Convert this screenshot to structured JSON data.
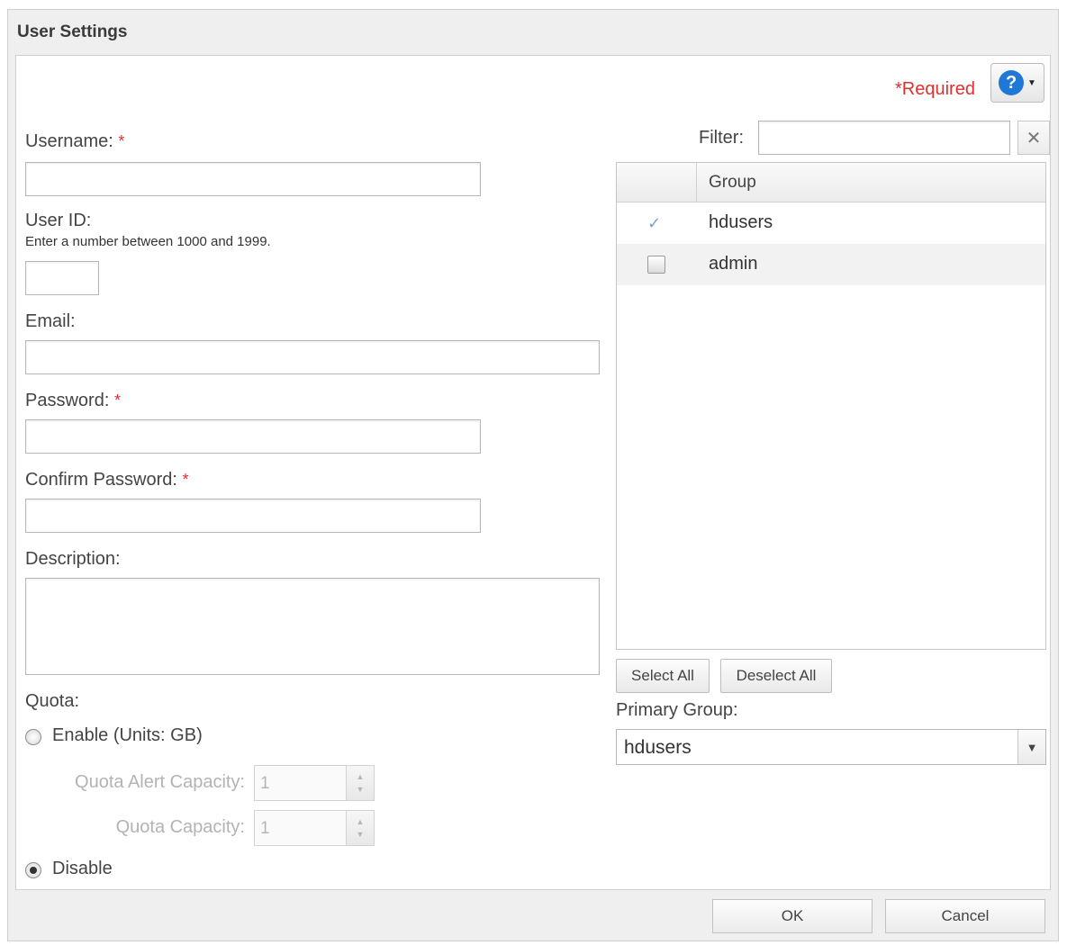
{
  "window": {
    "title": "User Settings"
  },
  "header": {
    "required_note": "*Required"
  },
  "form": {
    "username": {
      "label": "Username:",
      "marker": "*",
      "value": ""
    },
    "user_id": {
      "label": "User ID:",
      "hint": "Enter a number between 1000 and 1999.",
      "value": ""
    },
    "email": {
      "label": "Email:",
      "value": ""
    },
    "password": {
      "label": "Password:",
      "marker": "*",
      "value": ""
    },
    "confirm_password": {
      "label": "Confirm Password:",
      "marker": "*",
      "value": ""
    },
    "description": {
      "label": "Description:",
      "value": ""
    },
    "quota": {
      "label": "Quota:",
      "enable_label": "Enable (Units: GB)",
      "disable_label": "Disable",
      "selected": "disable",
      "alert_capacity_label": "Quota Alert Capacity:",
      "alert_capacity_value": "1",
      "capacity_label": "Quota Capacity:",
      "capacity_value": "1"
    }
  },
  "groups": {
    "filter_label": "Filter:",
    "filter_value": "",
    "clear_icon_glyph": "✕",
    "column_header": "Group",
    "rows": [
      {
        "name": "hdusers",
        "checked": true
      },
      {
        "name": "admin",
        "checked": false
      }
    ],
    "select_all_label": "Select All",
    "deselect_all_label": "Deselect All",
    "primary_group_label": "Primary Group:",
    "primary_group_value": "hdusers"
  },
  "footer": {
    "ok_label": "OK",
    "cancel_label": "Cancel"
  },
  "icons": {
    "help_icon": "help-circle",
    "help_glyph": "?",
    "dropdown_glyph": "▼",
    "check_glyph": "✓",
    "spin_up_glyph": "▲",
    "spin_down_glyph": "▼"
  },
  "colors": {
    "accent": "#1f78d6",
    "required": "#e03030"
  }
}
